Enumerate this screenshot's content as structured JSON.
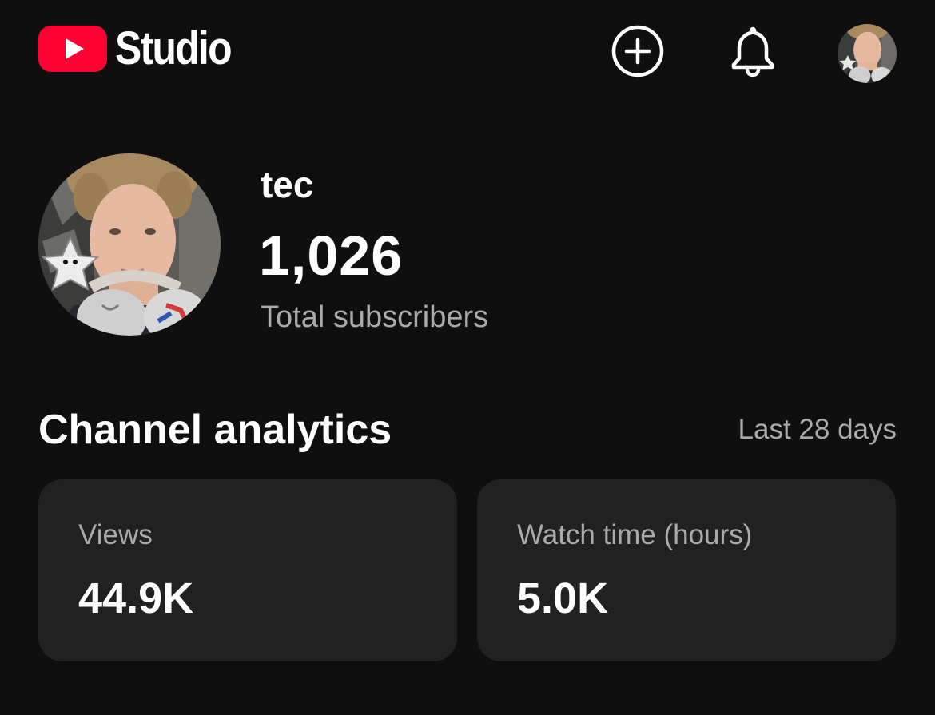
{
  "header": {
    "logo_text": "Studio",
    "brand_color": "#ff0000",
    "icons": [
      "create-plus-icon",
      "bell-icon",
      "account-avatar"
    ]
  },
  "channel": {
    "name": "tec",
    "subscriber_count": "1,026",
    "subscriber_label": "Total subscribers"
  },
  "analytics": {
    "title": "Channel analytics",
    "period": "Last 28 days",
    "cards": [
      {
        "label": "Views",
        "value": "44.9K"
      },
      {
        "label": "Watch time (hours)",
        "value": "5.0K"
      }
    ]
  },
  "colors": {
    "background": "#0f0f0f",
    "card": "#212121",
    "primary_text": "#ffffff",
    "secondary_text": "#aaaaaa"
  }
}
